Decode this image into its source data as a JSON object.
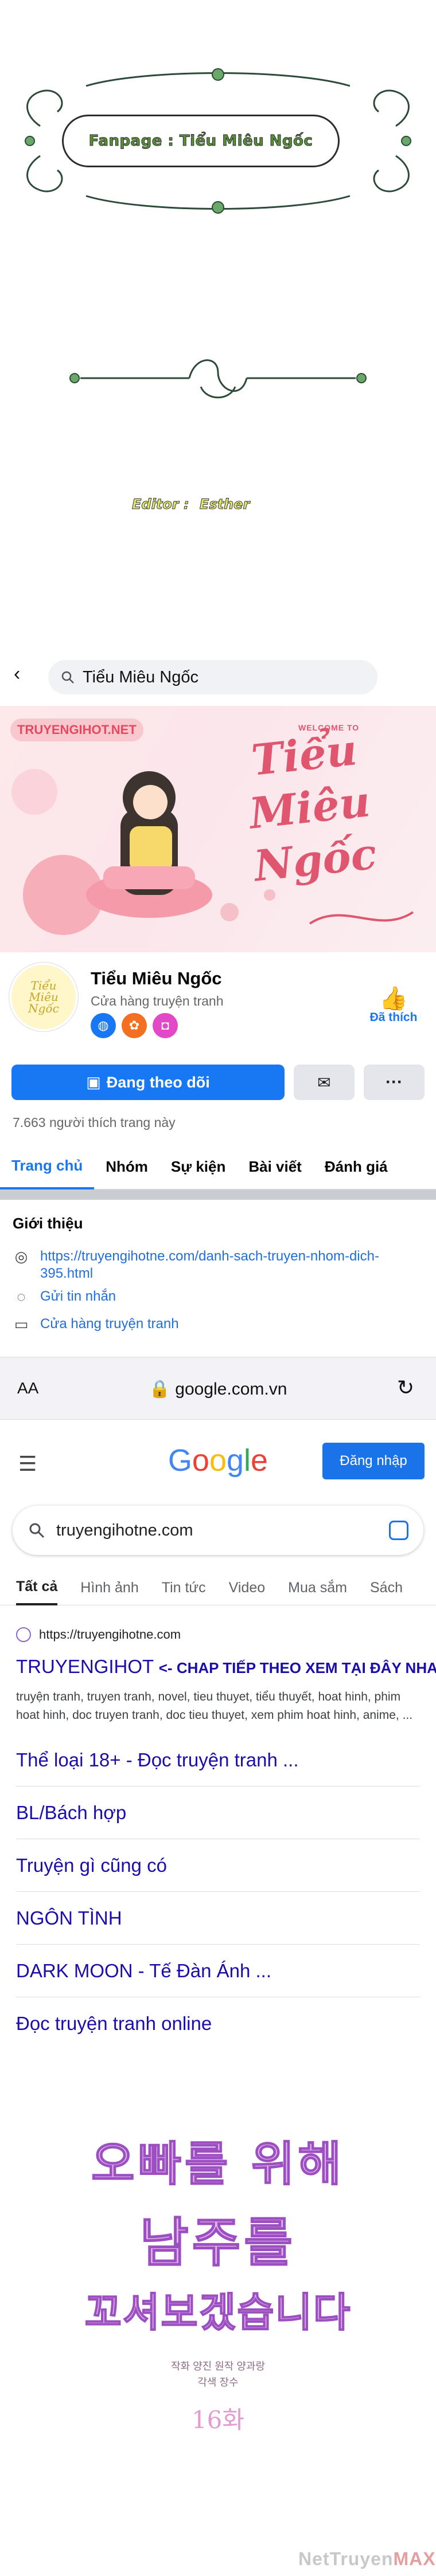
{
  "credit": {
    "fanpage": "Fanpage : Tiểu Miêu Ngốc",
    "editor_label": "Editor :",
    "editor_name": "Esther"
  },
  "facebook": {
    "search_text": "Tiểu Miêu Ngốc",
    "cover_tag": "TRUYENGIHOT.NET",
    "cover_welcome": "WELCOME TO",
    "cover_title": "Tiểu Miêu Ngốc",
    "page_name": "Tiểu Miêu Ngốc",
    "page_category": "Cửa hàng truyện tranh",
    "liked_label": "Đã thích",
    "follow_label": "Đang theo dõi",
    "likes_count": "7.663 người thích trang này",
    "tabs": [
      "Trang chủ",
      "Nhóm",
      "Sự kiện",
      "Bài viết",
      "Đánh giá"
    ],
    "intro_title": "Giới thiệu",
    "intro_link": "https://truyengihotne.com/danh-sach-truyen-nhom-dich-395.html",
    "intro_message": "Gửi tin nhắn",
    "intro_shop": "Cửa hàng truyện tranh",
    "colors": {
      "accent": "#1877f2",
      "muted": "#65676b"
    }
  },
  "safari": {
    "aa": "AA",
    "url": "google.com.vn"
  },
  "google": {
    "logo": "Google",
    "signin_label": "Đăng nhập",
    "search_text": "truyengihotne.com",
    "tabs": [
      "Tất cả",
      "Hình ảnh",
      "Tin tức",
      "Video",
      "Mua sắm",
      "Sách"
    ],
    "result_url": "https://truyengihotne.com",
    "result_title": "TRUYENGIHOT",
    "result_title_note": "<- CHAP TIẾP THEO XEM TẠI ĐÂY NHA",
    "result_snippet": "truyện tranh, truyen tranh, novel, tieu thuyet, tiểu thuyết, hoat hinh, phim hoat hinh, doc truyen tranh, doc tieu thuyet, xem phim hoat hinh, anime, ...",
    "sitelinks": [
      "Thể loại 18+ - Đọc truyện tranh ...",
      "BL/Bách hợp",
      "Truyện gì cũng có",
      "NGÔN TÌNH",
      "DARK MOON - Tế Đàn Ánh ...",
      "Đọc truyện tranh online"
    ]
  },
  "comic": {
    "title_line1": "오빠를 위해",
    "title_line2": "남주를",
    "title_line3": "꼬셔보겠습니다",
    "credits_line1": "작화 양진     원작 양과랑",
    "credits_line2": "각색 장수",
    "chapter": "16화",
    "watermark_main": "NetTruyen",
    "watermark_max": "MAX"
  }
}
